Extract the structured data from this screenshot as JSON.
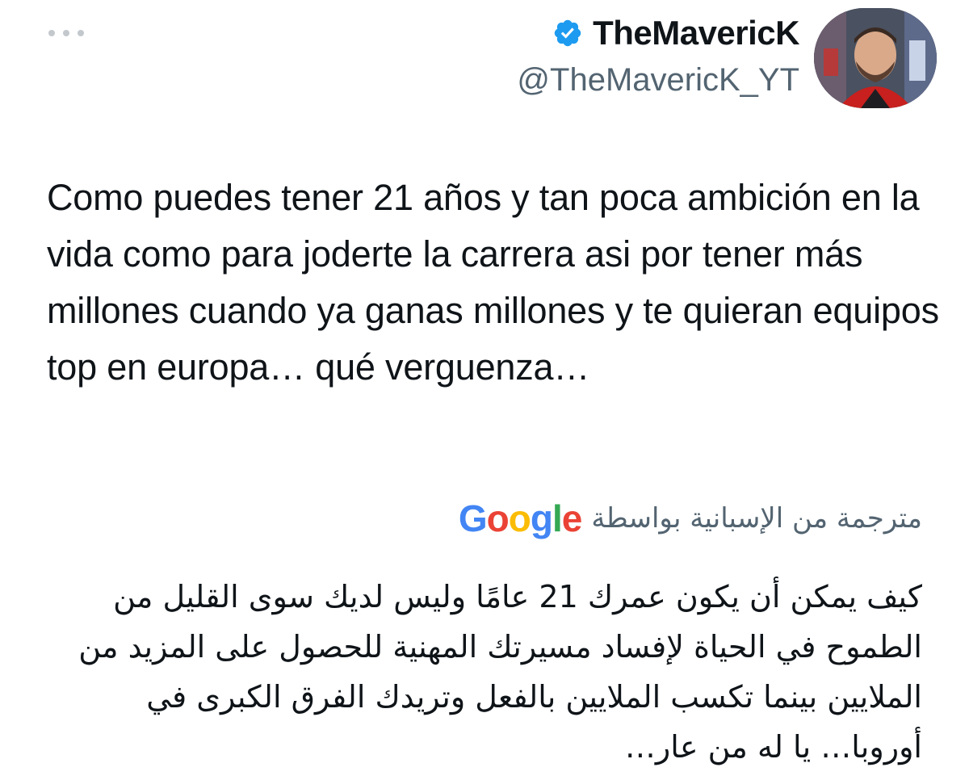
{
  "tweet": {
    "more_icon": "more-horizontal-icon",
    "author": {
      "display_name": "TheMaverick",
      "display_name_exact": "TheMavericK",
      "handle": "@TheMavericK_YT",
      "verified_icon": "verified-badge-icon",
      "verified_color": "#1d9bf0",
      "avatar_icon": "avatar-photo"
    },
    "text": "Como puedes tener 21 años y tan poca ambición en la vida como para joderte la carrera asi por tener más millones cuando ya ganas millones y te quieran equipos top en europa… qué verguenza…",
    "translation": {
      "label": "مترجمة من الإسبانية بواسطة",
      "provider": "Google",
      "text": "كيف يمكن أن يكون عمرك 21 عامًا وليس لديك سوى القليل من الطموح في الحياة لإفساد مسيرتك المهنية للحصول على المزيد من الملايين بينما تكسب الملايين بالفعل وتريدك الفرق الكبرى في أوروبا… يا له من عار…"
    }
  },
  "colors": {
    "text_primary": "#0f1419",
    "text_secondary": "#536471",
    "google_blue": "#4285F4",
    "google_red": "#EA4335",
    "google_yellow": "#FBBC05",
    "google_green": "#34A853"
  }
}
